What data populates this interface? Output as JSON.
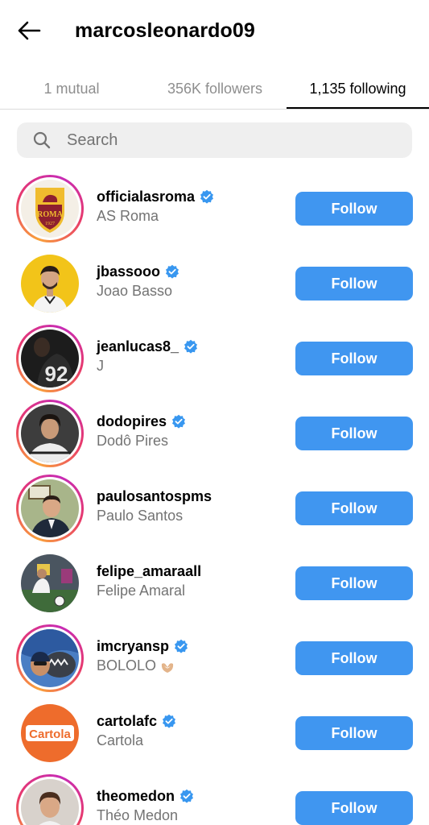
{
  "header": {
    "title": "marcosleonardo09",
    "back_icon": "arrow-left-icon"
  },
  "tabs": [
    {
      "label": "1 mutual",
      "active": false
    },
    {
      "label": "356K followers",
      "active": false
    },
    {
      "label": "1,135 following",
      "active": true
    }
  ],
  "search": {
    "placeholder": "Search",
    "value": "",
    "icon": "search-icon"
  },
  "accounts": [
    {
      "username": "officialasroma",
      "full_name": "AS Roma",
      "verified": true,
      "follow_label": "Follow",
      "story_ring": true
    },
    {
      "username": "jbassooo",
      "full_name": "Joao Basso",
      "verified": true,
      "follow_label": "Follow",
      "story_ring": false
    },
    {
      "username": "jeanlucas8_",
      "full_name": "J",
      "verified": true,
      "follow_label": "Follow",
      "story_ring": true
    },
    {
      "username": "dodopires",
      "full_name": "Dodô Pires",
      "verified": true,
      "follow_label": "Follow",
      "story_ring": true
    },
    {
      "username": "paulosantospms",
      "full_name": "Paulo Santos",
      "verified": false,
      "follow_label": "Follow",
      "story_ring": true
    },
    {
      "username": "felipe_amaraall",
      "full_name": "Felipe Amaral",
      "verified": false,
      "follow_label": "Follow",
      "story_ring": false
    },
    {
      "username": "imcryansp",
      "full_name": "BOLOLO",
      "verified": true,
      "follow_label": "Follow",
      "story_ring": true
    },
    {
      "username": "cartolafc",
      "full_name": "Cartola",
      "verified": true,
      "follow_label": "Follow",
      "story_ring": false
    },
    {
      "username": "theomedon",
      "full_name": "Théo Medon",
      "verified": true,
      "follow_label": "Follow",
      "story_ring": true
    }
  ],
  "logo_text": {
    "roma": "ROMA",
    "roma_year": "1927",
    "cartola": "Cartola"
  },
  "colors": {
    "follow_button": "#4096f0",
    "verified_badge": "#3897f0",
    "secondary_text": "#737373"
  }
}
